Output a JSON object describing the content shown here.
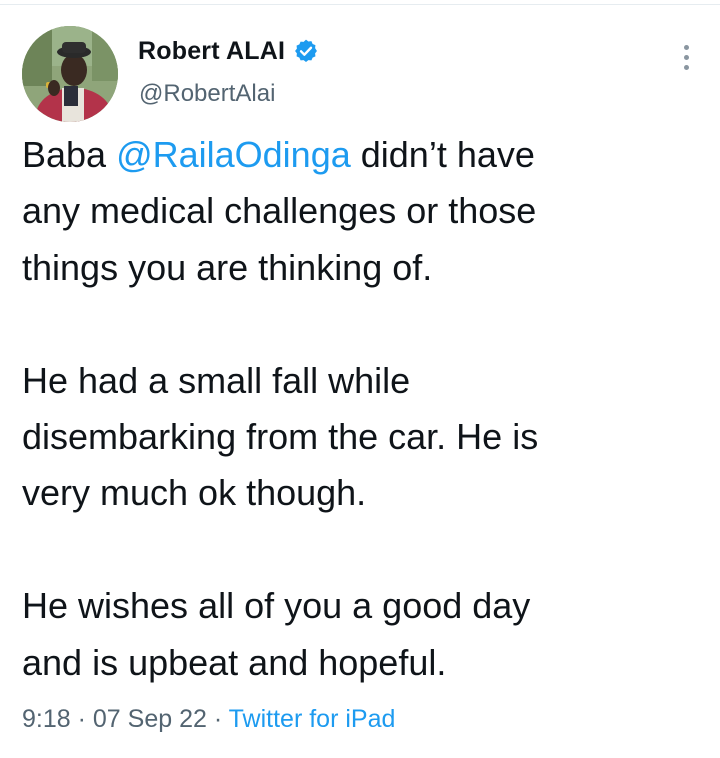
{
  "author": {
    "name": "Robert ALAI",
    "handle": "@RobertAlai",
    "verified": true
  },
  "icons": {
    "verified": "verified-badge-icon",
    "more": "more-options-icon"
  },
  "tweet": {
    "line_1": {
      "prefix": "Baba ",
      "mention": "@RailaOdinga",
      "suffix": " didn’t have"
    },
    "line_2": "any medical challenges or those",
    "line_3": "things you are thinking of.",
    "line_4": "He had a small fall while",
    "line_5": "disembarking from the car. He is",
    "line_6": "very much ok though.",
    "line_7": "He wishes all of you a good day",
    "line_8": "and is upbeat and hopeful."
  },
  "meta": {
    "time": "9:18",
    "separator": " · ",
    "date": "07 Sep 22",
    "source": "Twitter for iPad"
  },
  "colors": {
    "link": "#1d9bf0",
    "text": "#0f1419",
    "secondary": "#536471"
  }
}
